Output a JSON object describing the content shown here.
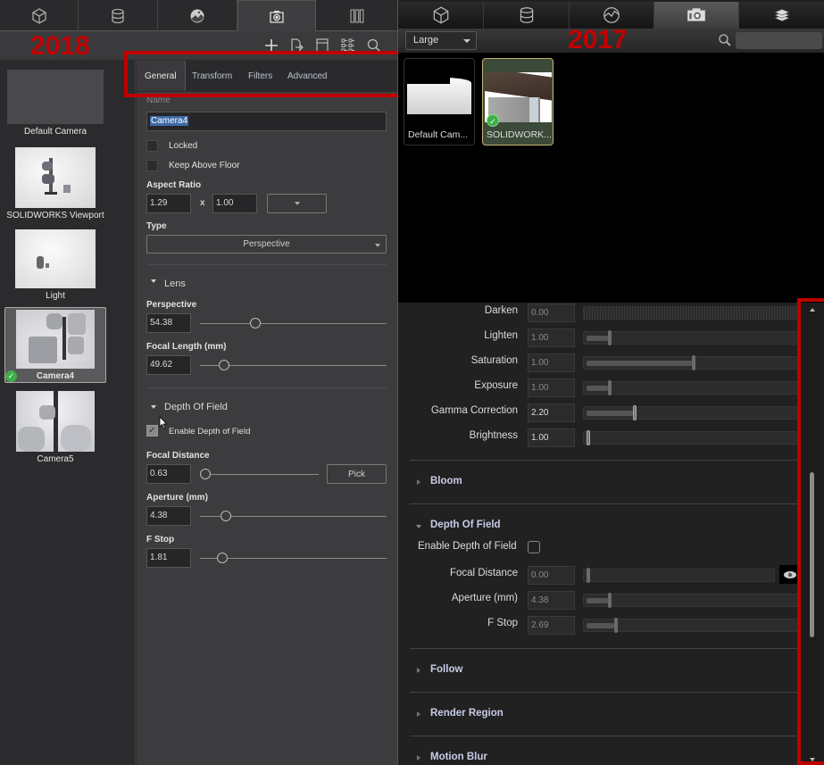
{
  "left_panel": {
    "version_label": "2018",
    "top_tabs": [
      {
        "icon": "cube-icon",
        "active": false
      },
      {
        "icon": "database-icon",
        "active": false
      },
      {
        "icon": "environment-icon",
        "active": false
      },
      {
        "icon": "camera-icon",
        "active": true
      },
      {
        "icon": "library-icon",
        "active": false
      }
    ],
    "toolbar_icons": [
      "add-icon",
      "import-icon",
      "layout-icon",
      "list-view-icon",
      "search-icon"
    ],
    "cameras": [
      {
        "label": "Default Camera",
        "selected": false,
        "active": false
      },
      {
        "label": "SOLIDWORKS Viewport",
        "selected": false,
        "active": false
      },
      {
        "label": "Light",
        "selected": false,
        "active": false
      },
      {
        "label": "Camera4",
        "selected": true,
        "active": true
      },
      {
        "label": "Camera5",
        "selected": false,
        "active": false
      }
    ],
    "property_tabs": [
      "General",
      "Transform",
      "Filters",
      "Advanced"
    ],
    "active_property_tab": "General",
    "general": {
      "name_label": "Name",
      "name_value": "Camera4",
      "locked_label": "Locked",
      "locked": false,
      "keep_above_floor_label": "Keep Above Floor",
      "keep_above_floor": false,
      "aspect_ratio_label": "Aspect Ratio",
      "aspect_w": "1.29",
      "aspect_x": "x",
      "aspect_h": "1.00",
      "type_label": "Type",
      "type_value": "Perspective"
    },
    "lens": {
      "title": "Lens",
      "perspective_label": "Perspective",
      "perspective_value": "54.38",
      "perspective_slider": 0.27,
      "focal_length_label": "Focal Length (mm)",
      "focal_length_value": "49.62",
      "focal_length_slider": 0.1
    },
    "depth_of_field": {
      "title": "Depth Of Field",
      "enable_label": "Enable Depth of Field",
      "enabled": true,
      "focal_distance_label": "Focal Distance",
      "focal_distance_value": "0.63",
      "focal_distance_slider": 0.0,
      "pick_label": "Pick",
      "aperture_label": "Aperture (mm)",
      "aperture_value": "4.38",
      "aperture_slider": 0.11,
      "fstop_label": "F Stop",
      "fstop_value": "1.81",
      "fstop_slider": 0.09
    }
  },
  "right_panel": {
    "version_label": "2017",
    "top_tabs": [
      {
        "icon": "cube-icon",
        "active": false
      },
      {
        "icon": "database-icon",
        "active": false
      },
      {
        "icon": "environment-icon",
        "active": false
      },
      {
        "icon": "camera-icon",
        "active": true
      },
      {
        "icon": "library-icon",
        "active": false
      }
    ],
    "size_dropdown": "Large",
    "search_placeholder": "",
    "cameras": [
      {
        "label": "Default Cam...",
        "selected": false,
        "active": false
      },
      {
        "label": "SOLIDWORK...",
        "selected": true,
        "active": true
      }
    ],
    "filters": [
      {
        "label": "Darken",
        "value": "0.00",
        "enabled": false,
        "fill": 0.0
      },
      {
        "label": "Lighten",
        "value": "1.00",
        "enabled": false,
        "fill": 0.1
      },
      {
        "label": "Saturation",
        "value": "1.00",
        "enabled": false,
        "fill": 0.5
      },
      {
        "label": "Exposure",
        "value": "1.00",
        "enabled": false,
        "fill": 0.1
      },
      {
        "label": "Gamma Correction",
        "value": "2.20",
        "enabled": true,
        "fill": 0.22
      },
      {
        "label": "Brightness",
        "value": "1.00",
        "enabled": true,
        "fill": 0.0
      }
    ],
    "sections": {
      "bloom": "Bloom",
      "depth_of_field": "Depth Of Field",
      "follow": "Follow",
      "render_region": "Render Region",
      "motion_blur": "Motion Blur"
    },
    "dof": {
      "enable_label": "Enable Depth of Field",
      "enabled": false,
      "rows": [
        {
          "label": "Focal Distance",
          "value": "0.00",
          "fill": 0.0
        },
        {
          "label": "Aperture (mm)",
          "value": "4.38",
          "fill": 0.1
        },
        {
          "label": "F Stop",
          "value": "2.69",
          "fill": 0.13
        }
      ]
    }
  },
  "colors": {
    "highlight_red": "#c00000",
    "check_green": "#3fae49",
    "selected_gold": "#c3b46a"
  }
}
